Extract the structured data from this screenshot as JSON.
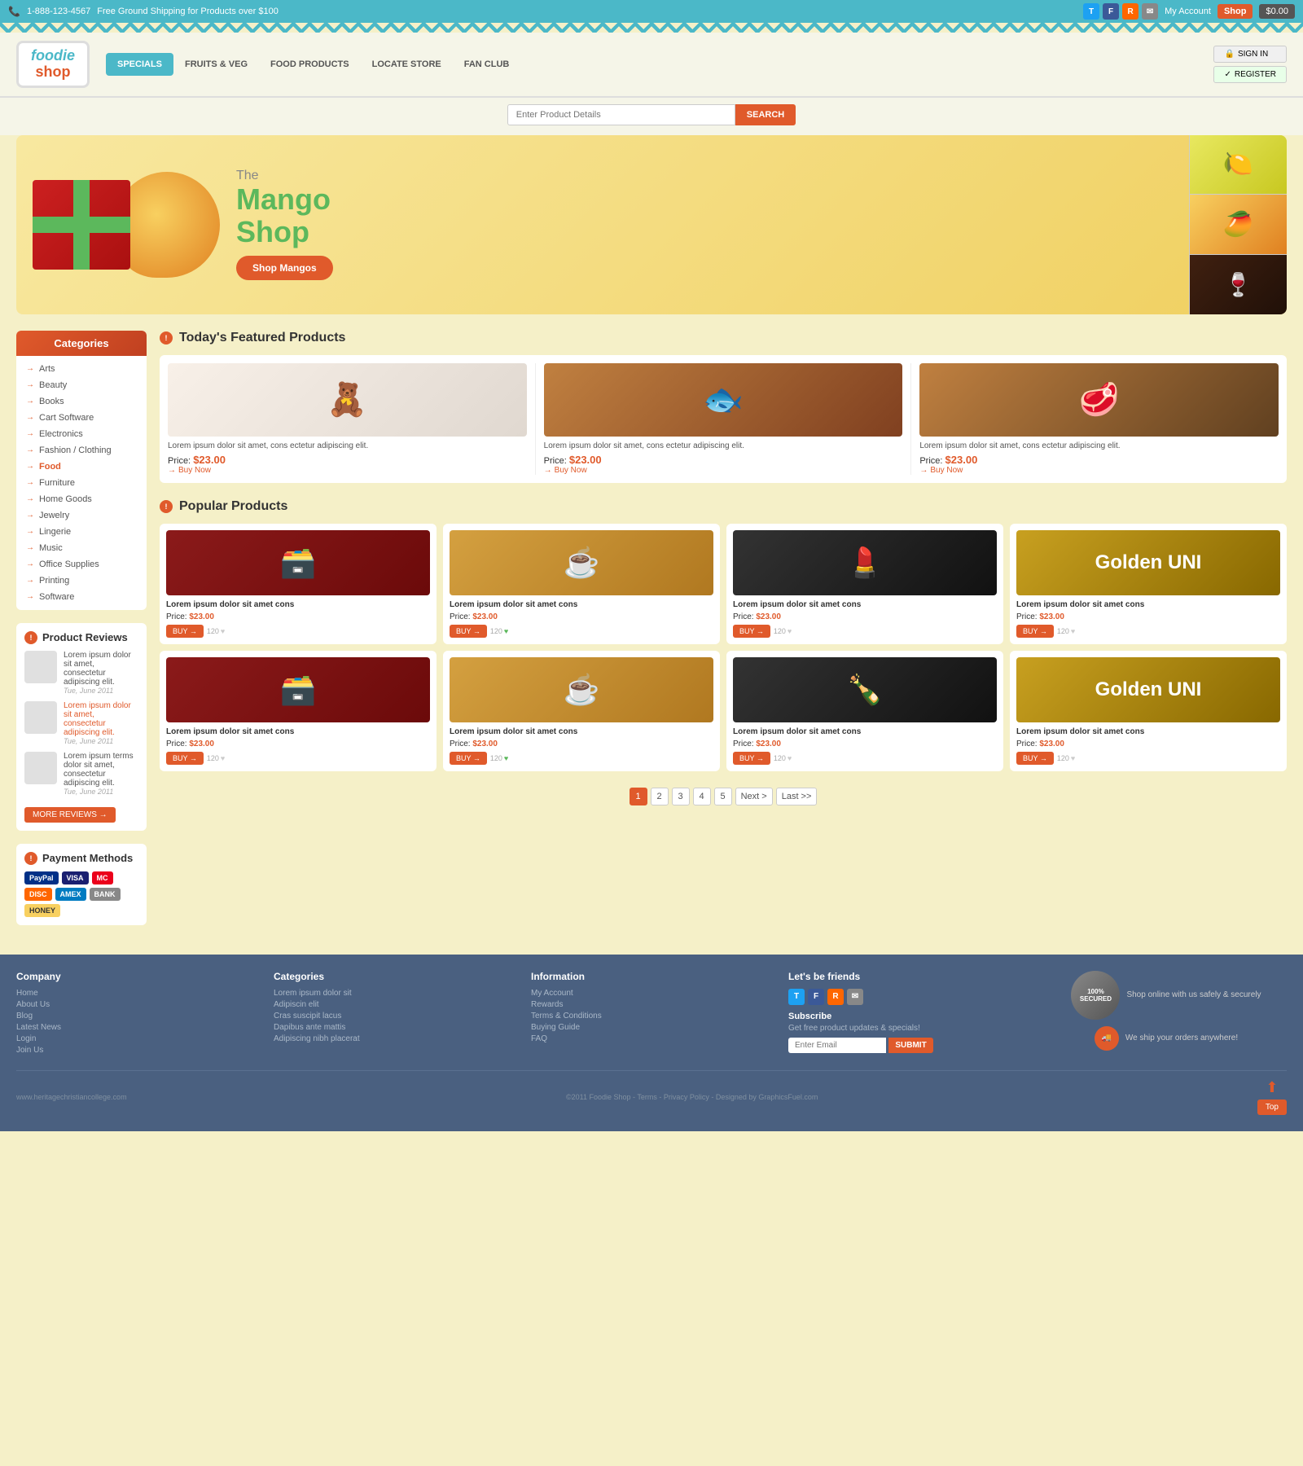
{
  "topbar": {
    "phone": "1-888-123-4567",
    "shipping_notice": "Free Ground Shipping for Products over $100",
    "my_account": "My Account",
    "shop_label": "Shop",
    "cart_amount": "$0.00",
    "social": [
      "T",
      "F",
      "R",
      "E"
    ]
  },
  "header": {
    "logo_line1": "foodie",
    "logo_line2": "shop",
    "nav_items": [
      "SPECIALS",
      "FRUITS & VEG",
      "FOOD PRODUCTS",
      "LOCATE STORE",
      "FAN CLUB"
    ],
    "active_nav": 0,
    "sign_in": "SIGN IN",
    "register": "REGISTER",
    "search_placeholder": "Enter Product Details",
    "search_btn": "SEARCH"
  },
  "hero": {
    "the": "The",
    "title_line1": "Mango",
    "title_line2": "Shop",
    "cta": "Shop Mangos"
  },
  "categories": {
    "title": "Categories",
    "items": [
      "Arts",
      "Beauty",
      "Books",
      "Cart Software",
      "Electronics",
      "Fashion / Clothing",
      "Food",
      "Furniture",
      "Home Goods",
      "Jewelry",
      "Lingerie",
      "Music",
      "Office Supplies",
      "Printing",
      "Software"
    ],
    "active": "Food"
  },
  "product_reviews": {
    "title": "Product Reviews",
    "reviews": [
      {
        "text": "Lorem ipsum dolor sit amet, consectetur adipiscing elit.",
        "date": "Tue, June 2011",
        "is_link": false
      },
      {
        "text": "Lorem ipsum dolor sit amet, consectetur adipiscing elit.",
        "date": "Tue, June 2011",
        "is_link": true
      },
      {
        "text": "Lorem ipsum terms dolor sit amet, consectetur adipiscing elit.",
        "date": "Tue, June 2011",
        "is_link": false
      }
    ],
    "more_reviews_btn": "MORE REVIEWS →"
  },
  "payment_methods": {
    "title": "Payment Methods",
    "methods": [
      "PayPal",
      "VISA",
      "MC",
      "DISC",
      "AMEX",
      "BANK",
      "HONEY ORDER"
    ]
  },
  "featured": {
    "title": "Today's Featured Products",
    "products": [
      {
        "desc": "Lorem ipsum dolor sit amet, cons ectetur adipiscing elit.",
        "price_label": "Price:",
        "price": "$23.00",
        "buy": "Buy Now"
      },
      {
        "desc": "Lorem ipsum dolor sit amet, cons ectetur adipiscing elit.",
        "price_label": "Price:",
        "price": "$23.00",
        "buy": "Buy Now"
      },
      {
        "desc": "Lorem ipsum dolor sit amet, cons ectetur adipiscing elit.",
        "price_label": "Price:",
        "price": "$23.00",
        "buy": "Buy Now"
      }
    ]
  },
  "popular": {
    "title": "Popular Products",
    "rows": [
      [
        {
          "title": "Lorem ipsum dolor sit amet cons",
          "price": "$23.00",
          "likes": "120",
          "img_class": "prod-img-1"
        },
        {
          "title": "Lorem ipsum dolor sit amet cons",
          "price": "$23.00",
          "likes": "120",
          "img_class": "prod-img-2"
        },
        {
          "title": "Lorem ipsum dolor sit amet cons",
          "price": "$23.00",
          "likes": "120",
          "img_class": "prod-img-3"
        },
        {
          "title": "Lorem ipsum dolor sit amet cons",
          "price": "$23.00",
          "likes": "120",
          "img_class": "prod-img-4"
        }
      ],
      [
        {
          "title": "Lorem ipsum dolor sit amet cons",
          "price": "$23.00",
          "likes": "120",
          "img_class": "prod-img-1"
        },
        {
          "title": "Lorem ipsum dolor sit amet cons",
          "price": "$23.00",
          "likes": "120",
          "img_class": "prod-img-2"
        },
        {
          "title": "Lorem ipsum dolor sit amet cons",
          "price": "$23.00",
          "likes": "120",
          "img_class": "prod-img-3"
        },
        {
          "title": "Lorem ipsum dolor sit amet cons",
          "price": "$23.00",
          "likes": "120",
          "img_class": "prod-img-4"
        }
      ]
    ],
    "buy_btn": "BUY →"
  },
  "pagination": {
    "pages": [
      "1",
      "2",
      "3",
      "4",
      "5"
    ],
    "active": "1",
    "next": "Next >",
    "last": "Last >>"
  },
  "footer": {
    "company_title": "Company",
    "company_links": [
      "Home",
      "About Us",
      "Blog",
      "Latest News",
      "Login",
      "Join Us"
    ],
    "categories_title": "Categories",
    "categories_links": [
      "Lorem ipsum dolor sit",
      "Adipiscin elit",
      "Cras suscipit lacus",
      "Dapibus ante mattis",
      "Adipiscing nibh placerat"
    ],
    "information_title": "Information",
    "information_links": [
      "My Account",
      "Rewards",
      "Terms & Conditions",
      "Buying Guide",
      "FAQ"
    ],
    "friends_title": "Let's be friends",
    "subscribe_label": "Subscribe",
    "subscribe_desc": "Get free product updates & specials!",
    "email_placeholder": "Enter Email",
    "submit_btn": "SUBMIT",
    "trust_text": "Shop online with us safely & securely",
    "ship_text": "We ship your orders anywhere!",
    "copyright": "©2011 Foodie Shop - Terms - Privacy Policy - Designed by GraphicsFuel.com",
    "website": "www.heritagechristiancollege.com",
    "top_btn": "Top"
  }
}
